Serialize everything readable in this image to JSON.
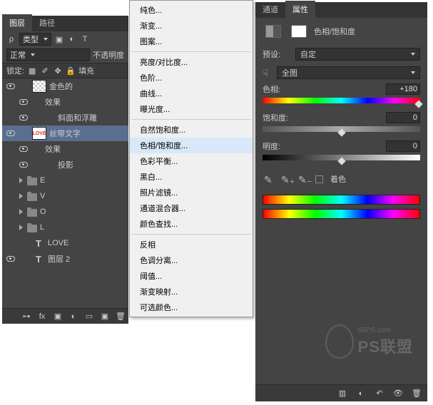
{
  "tabs_left": {
    "layers": "图层",
    "paths": "路径"
  },
  "filter": {
    "label": "类型",
    "kind": "ρ"
  },
  "blend": {
    "mode": "正常",
    "opacity_label": "不透明度"
  },
  "lock": {
    "label": "锁定:",
    "fill_label": "填充"
  },
  "layers": [
    {
      "name": "金色的"
    },
    {
      "name": "效果"
    },
    {
      "name": "斜面和浮雕"
    },
    {
      "name": "丝带文字",
      "thumb_text": "LOVE"
    },
    {
      "name": "效果"
    },
    {
      "name": "投影"
    },
    {
      "name": "E"
    },
    {
      "name": "V"
    },
    {
      "name": "O"
    },
    {
      "name": "L"
    },
    {
      "name": "LOVE"
    },
    {
      "name": "图层 2"
    }
  ],
  "menu": {
    "items": [
      "纯色...",
      "渐变...",
      "图案...",
      "-",
      "亮度/对比度...",
      "色阶...",
      "曲线...",
      "曝光度...",
      "-",
      "自然饱和度...",
      "色相/饱和度...",
      "色彩平衡...",
      "黑白...",
      "照片滤镜...",
      "通道混合器...",
      "颜色查找...",
      "-",
      "反相",
      "色调分离...",
      "阈值...",
      "渐变映射...",
      "可选颜色..."
    ],
    "highlighted": "色相/饱和度..."
  },
  "tabs_right": {
    "channels": "通道",
    "properties": "属性"
  },
  "prop": {
    "title": "色相/饱和度",
    "preset_label": "预设:",
    "preset_value": "自定",
    "edit_value": "全图",
    "hue_label": "色相:",
    "hue_value": "+180",
    "sat_label": "饱和度:",
    "sat_value": "0",
    "lig_label": "明度:",
    "lig_value": "0",
    "colorize": "着色"
  },
  "watermark": {
    "url": "68PS.com",
    "brand": "PS联盟"
  }
}
